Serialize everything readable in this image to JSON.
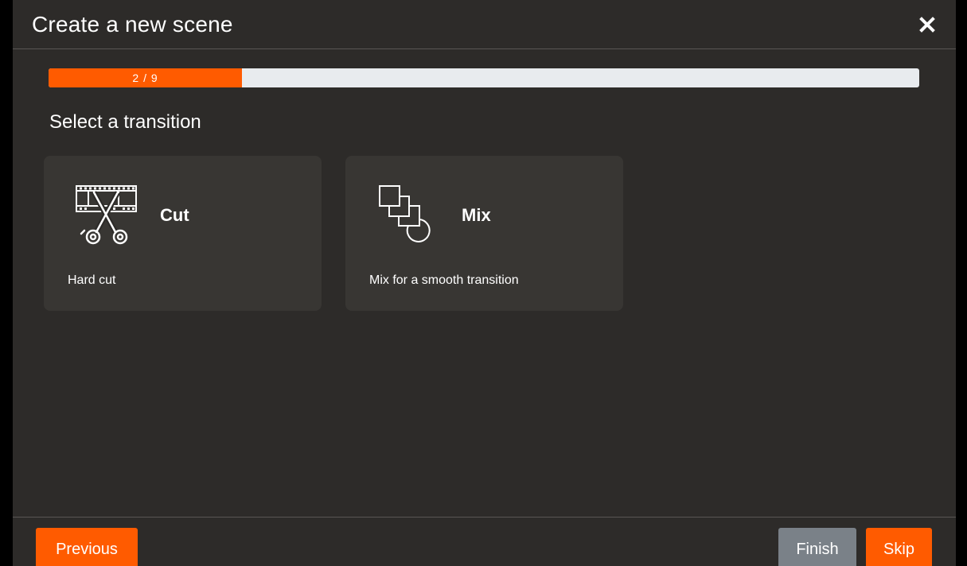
{
  "dialog": {
    "title": "Create a new scene",
    "close_icon": "close-icon"
  },
  "progress": {
    "label": "2 / 9",
    "current": 2,
    "total": 9,
    "fraction": 0.2222
  },
  "step": {
    "heading": "Select a transition"
  },
  "options": [
    {
      "title": "Cut",
      "description": "Hard cut",
      "icon": "film-scissors-icon"
    },
    {
      "title": "Mix",
      "description": "Mix for a smooth transition",
      "icon": "overlapping-shapes-icon"
    }
  ],
  "footer": {
    "previous_label": "Previous",
    "finish_label": "Finish",
    "skip_label": "Skip"
  },
  "colors": {
    "accent": "#ff5b00",
    "dialog_background": "#2d2b29",
    "card_background": "#383633",
    "progress_track": "#e8ebee",
    "finish_button": "#7a8188"
  }
}
